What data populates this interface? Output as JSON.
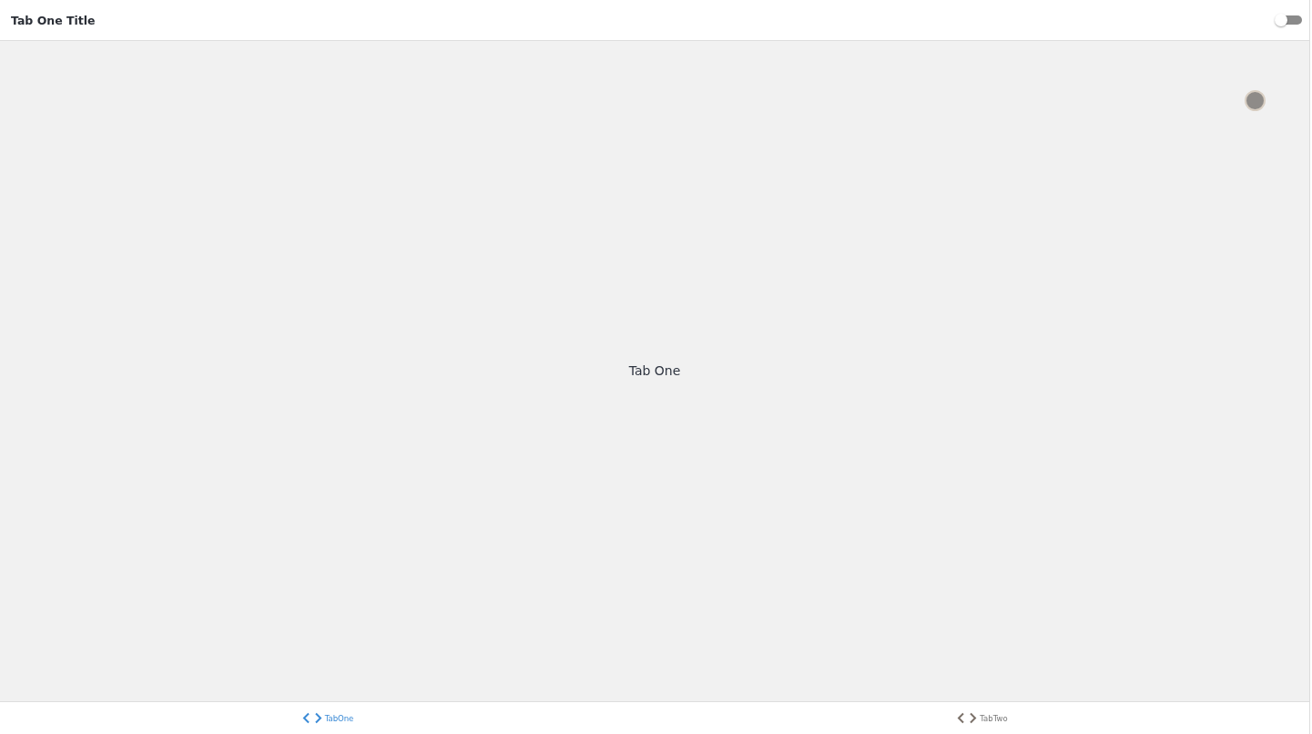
{
  "header": {
    "title": "Tab One Title",
    "toggle": {
      "on": false
    }
  },
  "content": {
    "text": "Tab One"
  },
  "tabs": [
    {
      "label": "TabOne",
      "selected": true
    },
    {
      "label": "TabTwo",
      "selected": false
    }
  ]
}
